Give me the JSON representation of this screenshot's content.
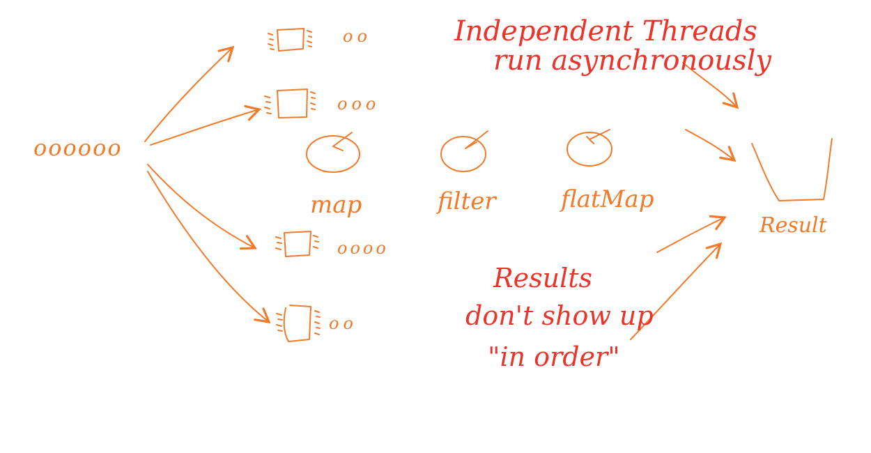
{
  "colors": {
    "orange": "#f07a2a",
    "red": "#e8342b",
    "background": "#ffffff"
  },
  "input_items": "oooooo",
  "cores": [
    {
      "items": "oo"
    },
    {
      "items": "ooo"
    },
    {
      "items": "oooo"
    },
    {
      "items": "oo"
    }
  ],
  "operations": [
    "map",
    "filter",
    "flatMap"
  ],
  "result_label": "Result",
  "notes": {
    "threads_line1": "Independent Threads",
    "threads_line2": "run asynchronously",
    "results_line1": "Results",
    "results_line2": "don't show up",
    "results_line3": "\"in order\""
  }
}
